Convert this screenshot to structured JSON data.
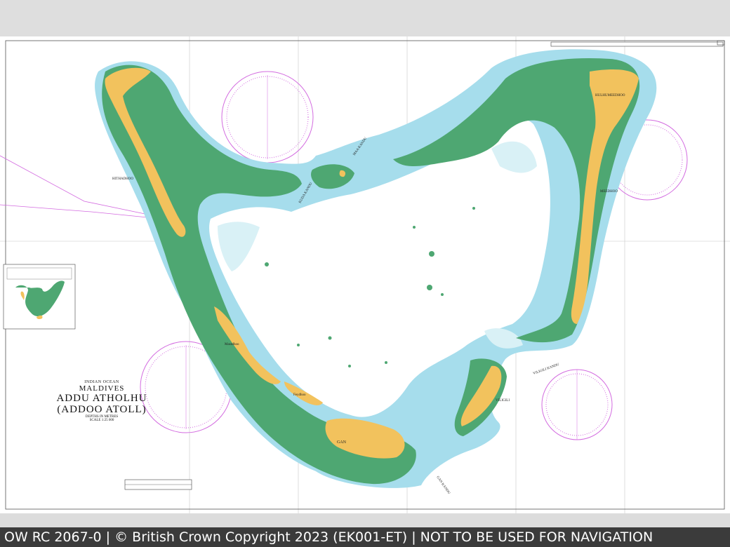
{
  "footer": {
    "text": "OW RC 2067-0 | © British Crown Copyright 2023 (EK001-ET) | NOT TO BE USED FOR NAVIGATION"
  },
  "title": {
    "ocean": "INDIAN OCEAN",
    "country": "MALDIVES",
    "name_line1": "ADDU ATHOLHU",
    "name_line2": "(ADDOO ATOLL)",
    "depths": "DEPTHS IN METRES",
    "scale": "SCALE 1:25 000"
  },
  "places": {
    "hithadhoo": "HITHADHOO",
    "gan": "GAN",
    "vilingili": "VILIGILI",
    "hulhumeedhoo": "HULHUMEEDHOO",
    "feydhoo": "Feydhoo",
    "maradhoo": "Maradhoo",
    "meedhoo": "MEEDHOO"
  },
  "channels": {
    "kudakandu": "KUDA KANDU",
    "maakandu": "MAA KANDU",
    "vilingili_kandu": "VILIGILI KANDU",
    "gan_kandu": "GAN KANDU"
  },
  "colors": {
    "land": "#f2c25d",
    "reef": "#4ea772",
    "shallow": "#a6ddec",
    "shoal": "#d9f1f6",
    "compass": "#d36be0"
  }
}
